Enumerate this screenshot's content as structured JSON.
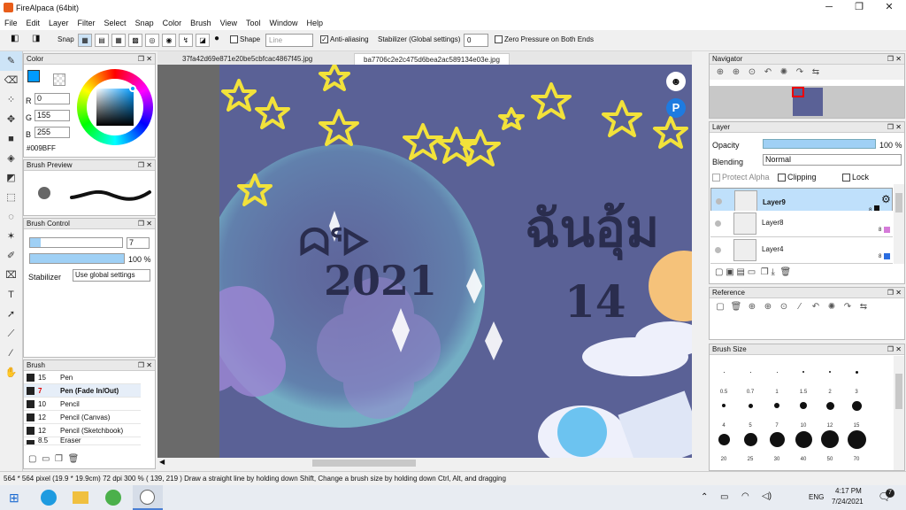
{
  "title": "FireAlpaca (64bit)",
  "window_controls": {
    "min": "─",
    "max": "❐",
    "close": "✕"
  },
  "menu": [
    "File",
    "Edit",
    "Layer",
    "Filter",
    "Select",
    "Snap",
    "Color",
    "Brush",
    "View",
    "Tool",
    "Window",
    "Help"
  ],
  "toolbar": {
    "snap_label": "Snap",
    "shape_label": "Shape",
    "shape_value": "Line",
    "antialias_label": "Anti-aliasing",
    "stabilizer_label": "Stabilizer (Global settings)",
    "stabilizer_value": "0",
    "zero_pressure_label": "Zero Pressure on Both Ends"
  },
  "color_panel": {
    "title": "Color",
    "r": "0",
    "g": "155",
    "b": "255",
    "hex": "#009BFF",
    "r_label": "R",
    "g_label": "G",
    "b_label": "B",
    "fg": "#009BFF"
  },
  "brush_preview": {
    "title": "Brush Preview"
  },
  "brush_control": {
    "title": "Brush Control",
    "size": "7",
    "opacity": "100 %",
    "stabilizer_label": "Stabilizer",
    "stabilizer_value": "Use global settings"
  },
  "brush_panel": {
    "title": "Brush",
    "items": [
      {
        "size": "15",
        "name": "Pen"
      },
      {
        "size": "7",
        "name": "Pen (Fade In/Out)"
      },
      {
        "size": "10",
        "name": "Pencil"
      },
      {
        "size": "12",
        "name": "Pencil (Canvas)"
      },
      {
        "size": "12",
        "name": "Pencil (Sketchbook)"
      },
      {
        "size": "8.5",
        "name": "Eraser"
      }
    ]
  },
  "tabs": [
    "37fa42d69e871e20be5cbfcac4867f45.jpg",
    "ba7706c2e2c475d6bea2ac589134e03e.jpg"
  ],
  "navigator": {
    "title": "Navigator"
  },
  "layer_panel": {
    "title": "Layer",
    "opacity_label": "Opacity",
    "opacity_value": "100 %",
    "blending_label": "Blending",
    "blending_value": "Normal",
    "protect_alpha": "Protect Alpha",
    "clipping": "Clipping",
    "lock": "Lock",
    "layers": [
      {
        "name": "Layer9",
        "bits": "8",
        "color": "#111111"
      },
      {
        "name": "Layer8",
        "bits": "8",
        "color": "#d57bd9"
      },
      {
        "name": "Layer4",
        "bits": "8",
        "color": "#2b6de0"
      }
    ]
  },
  "reference": {
    "title": "Reference"
  },
  "brush_size": {
    "title": "Brush Size",
    "labels": [
      "0.5",
      "0.7",
      "1",
      "1.5",
      "2",
      "3",
      "4",
      "5",
      "7",
      "10",
      "12",
      "15",
      "20",
      "25",
      "30",
      "40",
      "50",
      "70"
    ]
  },
  "status": "564 * 564 pixel   (19.9 * 19.9cm)   72 dpi   300 %   ( 139, 219 )   Draw a straight line by holding down Shift, Change a brush size by holding down Ctrl, Alt, and dragging",
  "taskbar": {
    "lang": "ENG",
    "time": "4:17 PM",
    "date": "7/24/2021",
    "notif": "7"
  },
  "canvas_text": {
    "line1": "ᗣᕐᐅ",
    "line2": "2021",
    "line3": "ฉันอุ้ม",
    "line4": "14"
  }
}
